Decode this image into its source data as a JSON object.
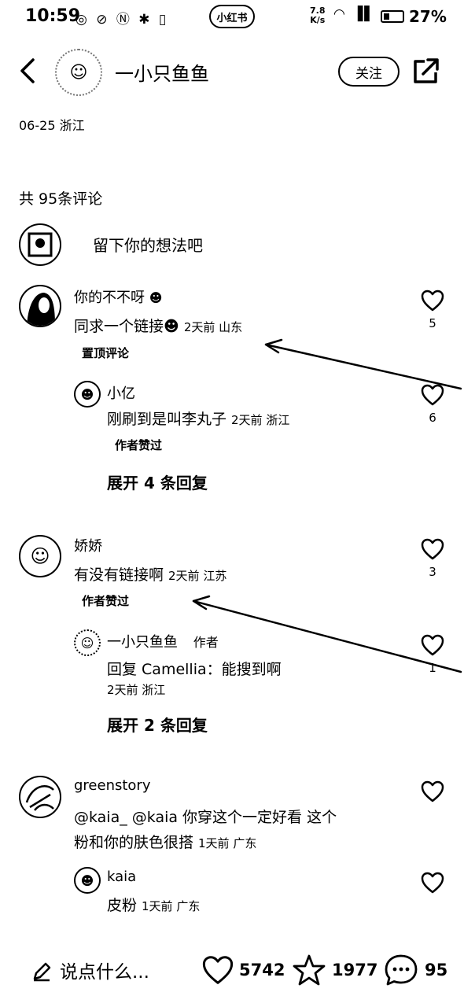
{
  "status_bar": {
    "time": "10:59",
    "left_icons": "◎ ⊘ Ⓝ ✱ ▯",
    "center_app": "小红书",
    "net_speed": "7.8",
    "net_unit": "K/s",
    "right_icons": "◠ ▐▌",
    "battery": "27%"
  },
  "header": {
    "author_name": "一小只鱼鱼",
    "follow_label": "关注",
    "avatar_glyph": "☺"
  },
  "post": {
    "meta": "06-25 浙江",
    "comment_total": "共 95条评论",
    "input_prompt": "留下你的想法吧"
  },
  "comments": [
    {
      "name": "你的不不呀",
      "name_emoji": "☻",
      "text": "同求一个链接",
      "text_emoji": "☻",
      "meta": "2天前 山东",
      "tag": "置顶评论",
      "likes": "5",
      "reply": {
        "name": "小亿",
        "text": "刚刷到是叫李丸子",
        "meta": "2天前 浙江",
        "tag": "作者赞过",
        "likes": "6"
      },
      "expand": "展开 4 条回复"
    },
    {
      "name": "娇娇",
      "text": "有没有链接啊",
      "meta": "2天前 江苏",
      "tag": "作者赞过",
      "likes": "3",
      "reply": {
        "name": "一小只鱼鱼",
        "author_tag": "作者",
        "text": "回复  Camellia：能搜到啊",
        "meta": "2天前 浙江",
        "likes": "1"
      },
      "expand": "展开 2 条回复"
    },
    {
      "name": "greenstory",
      "text_line1": "@kaia_  @kaia  你穿这个一定好看 这个",
      "text_line2": "粉和你的肤色很搭",
      "meta": "1天前 广东",
      "reply": {
        "name": "kaia",
        "text": "皮粉",
        "meta": "1天前 广东"
      }
    }
  ],
  "bottom_bar": {
    "placeholder": "说点什么...",
    "likes": "5742",
    "collects": "1977",
    "comments": "95"
  }
}
